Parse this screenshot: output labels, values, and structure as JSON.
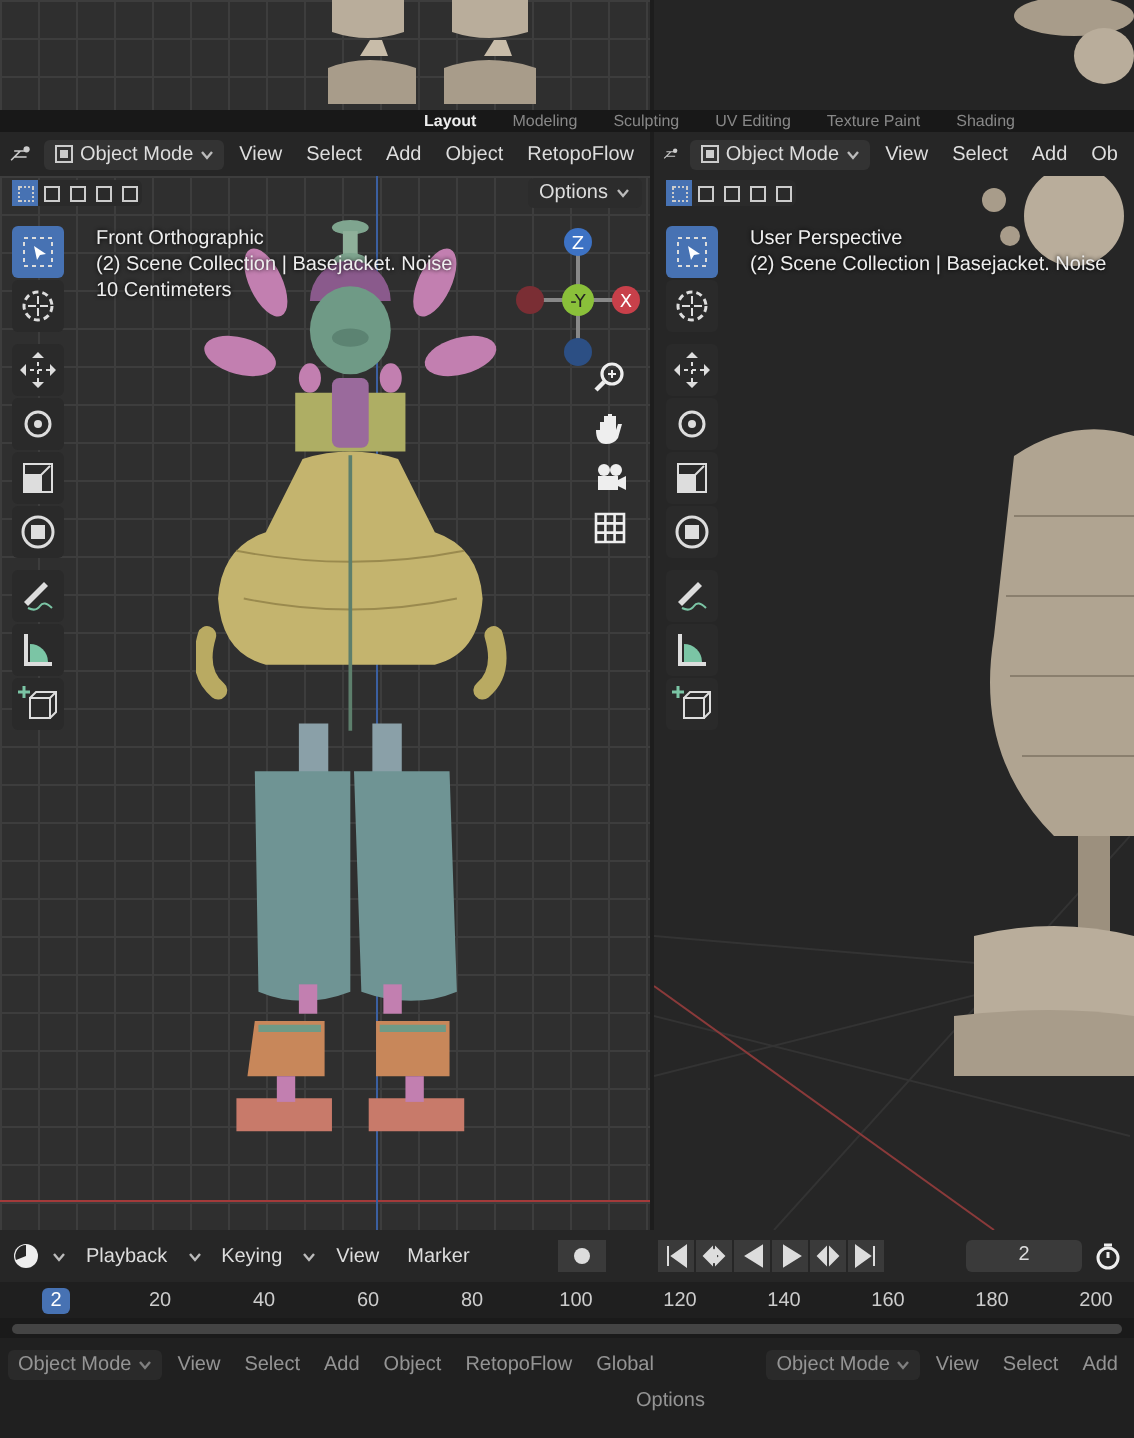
{
  "workspace_tabs": [
    {
      "label": "Layout",
      "selected": true
    },
    {
      "label": "Modeling",
      "selected": false
    },
    {
      "label": "Sculpting",
      "selected": false
    },
    {
      "label": "UV Editing",
      "selected": false
    },
    {
      "label": "Texture Paint",
      "selected": false
    },
    {
      "label": "Shading",
      "selected": false
    }
  ],
  "left_viewport": {
    "mode": "Object Mode",
    "menus": [
      "View",
      "Select",
      "Add",
      "Object",
      "RetopoFlow"
    ],
    "select_modes": [
      {
        "selected": true
      },
      {
        "selected": false
      },
      {
        "selected": false
      },
      {
        "selected": false
      },
      {
        "selected": false
      }
    ],
    "options": "Options",
    "overlay": [
      "Front Orthographic",
      "(2) Scene Collection | Basejacket. Noise",
      "10 Centimeters"
    ],
    "tools": [
      {
        "kind": "select",
        "selected": true
      },
      {
        "kind": "cursor",
        "selected": false
      },
      {
        "kind": "move",
        "selected": false
      },
      {
        "kind": "rotate",
        "selected": false
      },
      {
        "kind": "scale",
        "selected": false
      },
      {
        "kind": "transform",
        "selected": false
      },
      {
        "kind": "annotate",
        "selected": false
      },
      {
        "kind": "measure",
        "selected": false
      },
      {
        "kind": "add_cube",
        "selected": false
      }
    ],
    "gizmo": {
      "z": "Z",
      "y": "-Y",
      "x": "X"
    }
  },
  "right_viewport": {
    "mode": "Object Mode",
    "menus": [
      "View",
      "Select",
      "Add",
      "Ob"
    ],
    "select_modes": [
      {
        "selected": true
      },
      {
        "selected": false
      },
      {
        "selected": false
      },
      {
        "selected": false
      },
      {
        "selected": false
      }
    ],
    "overlay": [
      "User Perspective",
      "(2) Scene Collection | Basejacket. Noise"
    ],
    "tools": [
      {
        "kind": "select",
        "selected": true
      },
      {
        "kind": "cursor",
        "selected": false
      },
      {
        "kind": "move",
        "selected": false
      },
      {
        "kind": "rotate",
        "selected": false
      },
      {
        "kind": "scale",
        "selected": false
      },
      {
        "kind": "transform",
        "selected": false
      },
      {
        "kind": "annotate",
        "selected": false
      },
      {
        "kind": "measure",
        "selected": false
      },
      {
        "kind": "add_cube",
        "selected": false
      }
    ]
  },
  "timeline": {
    "menus": [
      "Playback",
      "Keying",
      "View",
      "Marker"
    ],
    "current_frame": "2",
    "ruler": [
      {
        "label": "2",
        "selected": true
      },
      {
        "label": "20",
        "selected": false
      },
      {
        "label": "40",
        "selected": false
      },
      {
        "label": "60",
        "selected": false
      },
      {
        "label": "80",
        "selected": false
      },
      {
        "label": "100",
        "selected": false
      },
      {
        "label": "120",
        "selected": false
      },
      {
        "label": "140",
        "selected": false
      },
      {
        "label": "160",
        "selected": false
      },
      {
        "label": "180",
        "selected": false
      },
      {
        "label": "200",
        "selected": false
      }
    ]
  },
  "lower_header": {
    "left_mode": "Object Mode",
    "left_menus": [
      "View",
      "Select",
      "Add",
      "Object",
      "RetopoFlow"
    ],
    "orientation": "Global",
    "options": "Options",
    "right_mode": "Object Mode",
    "right_menus": [
      "View",
      "Select",
      "Add"
    ]
  }
}
